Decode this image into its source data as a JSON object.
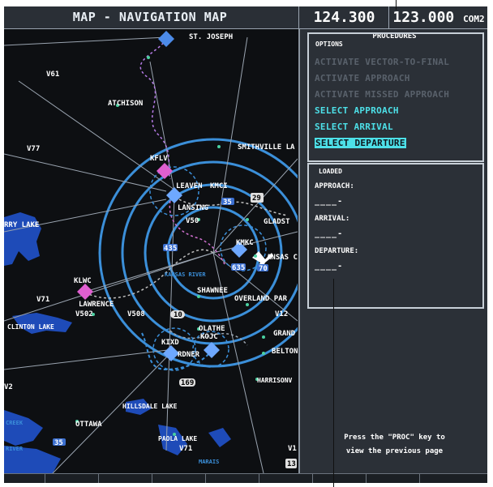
{
  "header": {
    "page_title": "MAP - NAVIGATION MAP",
    "freq_active": "124.300",
    "freq_standby": "123.000",
    "freq_unit": "COM2"
  },
  "map": {
    "labels": {
      "st_joseph": "ST. JOSEPH",
      "v61": "V61",
      "atchison": "ATCHISON",
      "v77": "V77",
      "kflv": "KFLV",
      "smithville": "SMITHVILLE LA",
      "leaven": "LEAVEN",
      "kmci": "KMCI",
      "lansing": "LANSING",
      "v50": "V50",
      "gladst": "GLADST",
      "rry_lake": "RRY LAKE",
      "kmkc": "KMKC",
      "kansas": "ANSAS C",
      "kansas_river": "KANSAS RIVER",
      "klwc": "KLWC",
      "v71": "V71",
      "lawrence": "LAWRENCE",
      "shawnee": "SHAWNEE",
      "overland": "OVERLAND PAR",
      "v502": "V502",
      "v508": "V508",
      "v12": "V12",
      "clinton": "CLINTON LAKE",
      "olathe": "OLATHE",
      "grand": "GRAND",
      "kojc": "KOJC",
      "kixd": "KIXD",
      "gardner": "RDNER",
      "belton": "BELTON",
      "harrisonville": "HARRISONV",
      "v2": "V2",
      "hillsdale": "HILLSDALE LAKE",
      "ottawa": "OTTAWA",
      "paola": "PAOLA LAKE",
      "v71b": "V71",
      "marais": "MARAIS",
      "creek": "CREEK",
      "river": "RIVER",
      "v1": "V1"
    },
    "shields": {
      "s35a": "35",
      "s10": "10",
      "s169": "169",
      "s35b": "35",
      "s29": "29",
      "s70": "70",
      "s435": "435",
      "s635": "635",
      "s13": "13"
    }
  },
  "procedures": {
    "title": "PROCEDURES",
    "options_tag": "OPTIONS",
    "options": [
      {
        "label": "ACTIVATE VECTOR-TO-FINAL"
      },
      {
        "label": "ACTIVATE APPROACH"
      },
      {
        "label": "ACTIVATE MISSED APPROACH"
      },
      {
        "label": "SELECT APPROACH"
      },
      {
        "label": "SELECT ARRIVAL"
      },
      {
        "label": "SELECT DEPARTURE"
      }
    ],
    "loaded_tag": "LOADED",
    "approach_label": "APPROACH:",
    "approach_value": "____-",
    "arrival_label": "ARRIVAL:",
    "arrival_value": "____-",
    "departure_label": "DEPARTURE:",
    "departure_value": "____-",
    "note_line1": "Press the \"PROC\" key to",
    "note_line2": "view the previous page"
  },
  "colors": {
    "cyan": "#4de0e8",
    "range_ring": "#3b8fd9",
    "background": "#0d0f12",
    "disabled": "#59616b"
  }
}
